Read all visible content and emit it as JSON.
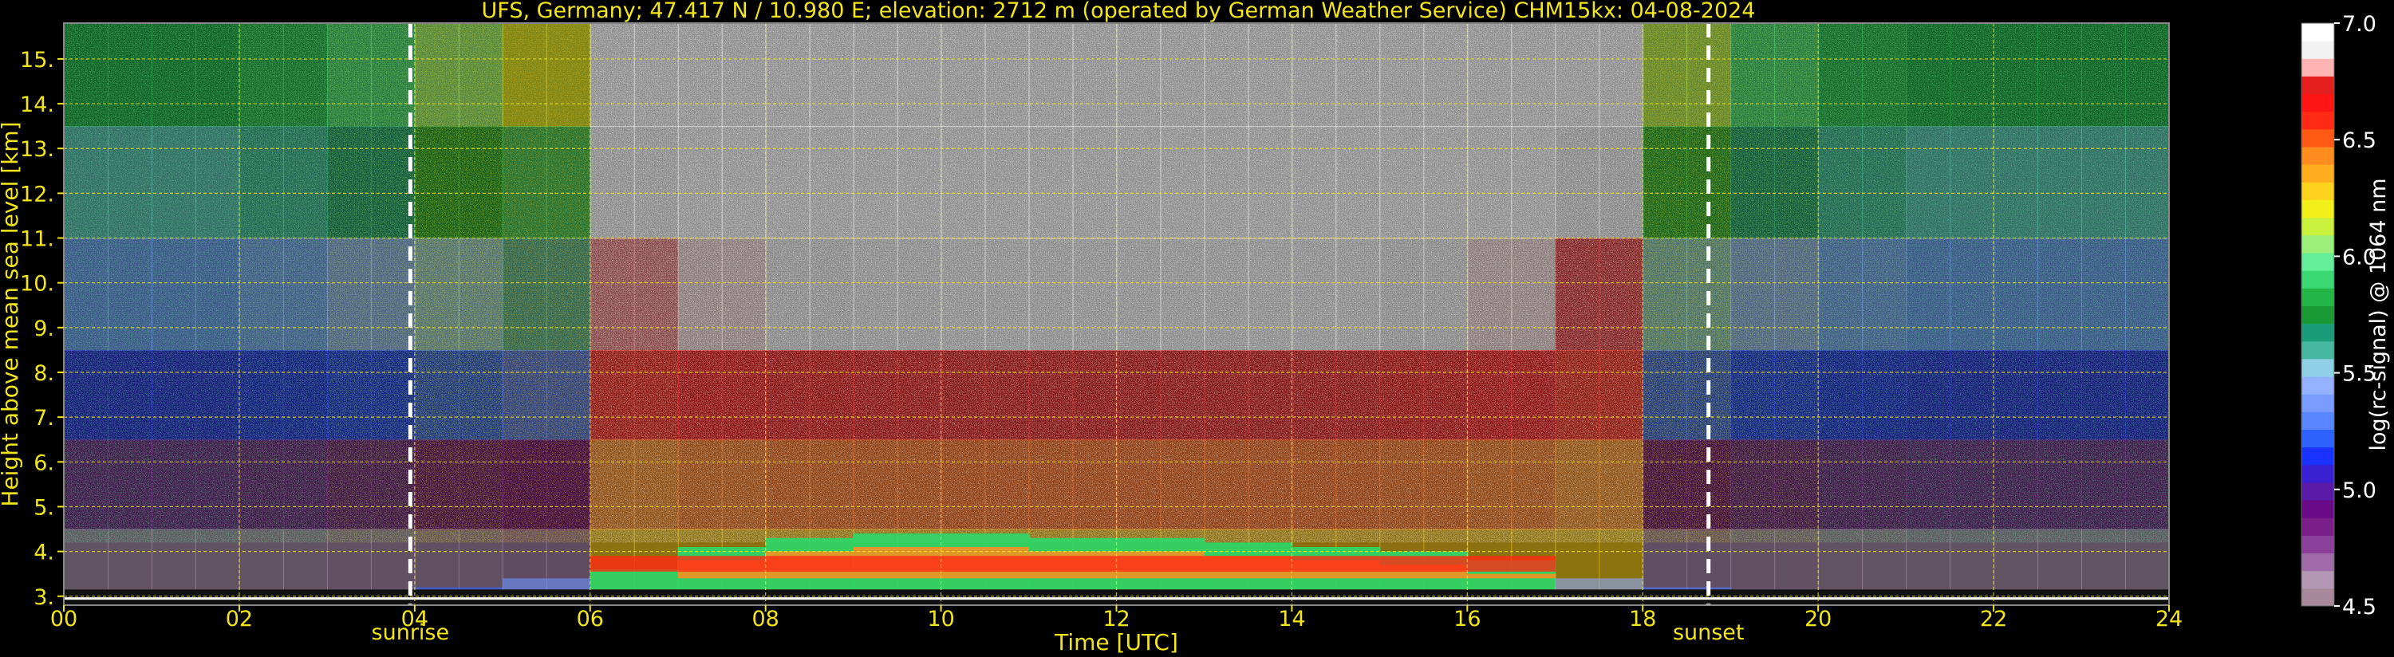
{
  "chart_data": {
    "type": "heatmap",
    "title": "UFS, Germany; 47.417 N / 10.980 E; elevation: 2712 m  (operated by German Weather Service)    CHM15kx: 04-08-2024",
    "xlabel": "Time [UTC]",
    "ylabel": "Height above mean sea level [km]",
    "xlim": [
      0,
      24
    ],
    "ylim": [
      2.8,
      15.8
    ],
    "x_ticks": [
      "00",
      "02",
      "04",
      "06",
      "08",
      "10",
      "12",
      "14",
      "16",
      "18",
      "20",
      "22",
      "24"
    ],
    "y_ticks": [
      "3.",
      "4.",
      "5.",
      "6.",
      "7.",
      "8.",
      "9.",
      "10.",
      "11.",
      "12.",
      "13.",
      "14.",
      "15."
    ],
    "grid": true,
    "markers": [
      {
        "label": "sunrise",
        "x": 3.95
      },
      {
        "label": "sunset",
        "x": 18.75
      }
    ],
    "colorbar": {
      "label": "log(rc-signal) @ 1064 nm",
      "range": [
        4.5,
        7.0
      ],
      "ticks": [
        "7.0",
        "6.5",
        "6.0",
        "5.5",
        "5.0",
        "4.5"
      ],
      "colors": [
        "#a7889a",
        "#b397b4",
        "#a06aa8",
        "#8a3f9a",
        "#7a1e8a",
        "#6a0a86",
        "#5a1aa8",
        "#3a1ed2",
        "#1a32ff",
        "#2e62ff",
        "#5a86ff",
        "#7a9cff",
        "#94b2ff",
        "#8fd0e6",
        "#46b8a0",
        "#1a9c78",
        "#1a9a34",
        "#23b548",
        "#3ad873",
        "#64ee9a",
        "#9cf07a",
        "#c8f03c",
        "#f2f01a",
        "#ffd21e",
        "#ffad1e",
        "#ff8c1e",
        "#ff5a14",
        "#ff2a14",
        "#ff1414",
        "#e41e1e",
        "#ffb4b4",
        "#f2f2f2",
        "#ffffff"
      ]
    },
    "signal_profile": {
      "hours": [
        0,
        1,
        2,
        3,
        4,
        5,
        6,
        7,
        8,
        9,
        10,
        11,
        12,
        13,
        14,
        15,
        16,
        17,
        18,
        19,
        20,
        21,
        22,
        23
      ],
      "daylight_background": [
        0.15,
        0.15,
        0.2,
        0.3,
        0.45,
        0.6,
        0.75,
        0.85,
        0.9,
        0.92,
        0.95,
        0.95,
        0.95,
        0.95,
        0.95,
        0.9,
        0.85,
        0.7,
        0.5,
        0.3,
        0.2,
        0.15,
        0.15,
        0.15
      ],
      "boundary_layer_top_km": [
        3.0,
        3.0,
        3.0,
        3.1,
        3.2,
        3.4,
        3.6,
        4.1,
        4.3,
        4.4,
        4.4,
        4.3,
        4.3,
        4.2,
        4.1,
        4.0,
        3.8,
        3.4,
        3.2,
        3.0,
        3.0,
        3.0,
        3.0,
        3.0
      ]
    }
  }
}
